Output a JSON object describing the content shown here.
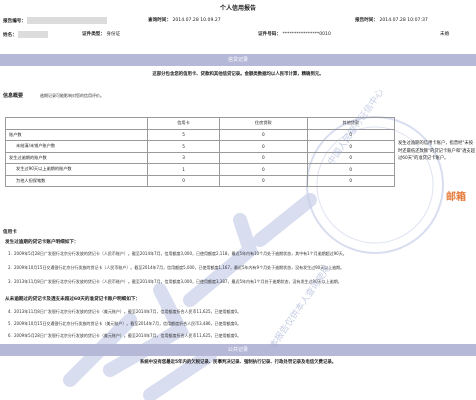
{
  "report": {
    "title": "个人信用报告"
  },
  "header": {
    "report_no_label": "报告编号：",
    "query_time_label": "查询时间：",
    "query_time": "2014.07.28 10.09.27",
    "report_time_label": "报告时间：",
    "report_time": "2014.07.28 10:07:37",
    "name_label": "姓名：",
    "id_type_label": "证件类型：",
    "id_type": "身份证",
    "id_no_label": "证件号码：",
    "id_no": "****************0010",
    "marital_status": "未婚"
  },
  "credit_section": {
    "banner": "信贷记录",
    "notice": "这部分包含您的信用卡、贷款和其他信贷记录。金额类数据均以人民币计算，精确到元。",
    "summary_title": "信息概要",
    "summary_note": "逾期记录可能影响对您的信用评价。",
    "columns": [
      "",
      "信用卡",
      "住房贷款",
      "其他贷款"
    ],
    "rows": [
      {
        "label": "账户数",
        "values": [
          "5",
          "0",
          "0"
        ]
      },
      {
        "label": "未结清/未销户账户数",
        "values": [
          "5",
          "0",
          "0"
        ]
      },
      {
        "label": "发生过逾期的账户数",
        "values": [
          "3",
          "0",
          "0"
        ]
      },
      {
        "label": "发生过90天以上逾期的账户数",
        "values": [
          "1",
          "0",
          "0"
        ]
      },
      {
        "label": "为他人担保笔数",
        "values": [
          "0",
          "0",
          "0"
        ]
      }
    ],
    "side_note": "发生过逾期的信用卡账户，指曾经\"未按时还最低还款额\"的贷记卡账户和\"透支超过60天\"的准贷记卡账户。"
  },
  "credit_card": {
    "title": "信用卡",
    "overdue_title": "发生过逾期的贷记卡账户明细如下：",
    "overdue_records": [
      "2009年5月28日广发银行北京分行发放的贷记卡（人民币账户）。截至2014年7月，信用额度3,000，已使用额度2,118，最近5年内有10个月处于逾期状态，其中有1个月逾期超过90天。",
      "2009年10月15日交通银行北京分行发放的贷记卡（人民币账户）。截至2014年7月，信用额度5,000，已使用额度1,167，最近5年内有9个月处于逾期状态，没有发生过90天以上逾期。",
      "2013年11月8日广发银行北京分行发放的贷记卡（人民币账户）。截至2014年7月，信用额度3,000，已使用额度3,387，最近5年内有1个月处于逾期状态，没有发生过90天以上逾期。"
    ],
    "normal_title": "从未逾期过的贷记卡及透支未超过60天的准贷记卡账户明细如下：",
    "normal_records": [
      "2013年11月8日广发银行北京分行发放的贷记卡（美元账户）。截至2014年7月，信用额度折合人民币11,625，已使用额度0。",
      "2009年10月15日交通银行北京分行发放的贷记卡（美元账户）。截至2014年7月，信用额度折合人民币3,486，已使用额度0。",
      "2009年5月28日广发银行北京分行发放的贷记卡（美元账户）。截至2014年7月，信用额度折合人民币11,625，已使用额度0。"
    ]
  },
  "public_section": {
    "banner": "公共记录",
    "notice": "系统中没有您最近5年内的欠税记录、民事判决记录、强制执行记录、行政处罚记录及电信欠费记录。"
  },
  "branding": {
    "logo_text": "邮箱"
  },
  "watermark": {
    "text": "中国人民银行征信中心",
    "seal_text": "本报告仅供本人查询使用"
  },
  "colors": {
    "banner": "#b6b8d8",
    "watermark": "#c8d0ea",
    "logo": "#e57b3c"
  }
}
